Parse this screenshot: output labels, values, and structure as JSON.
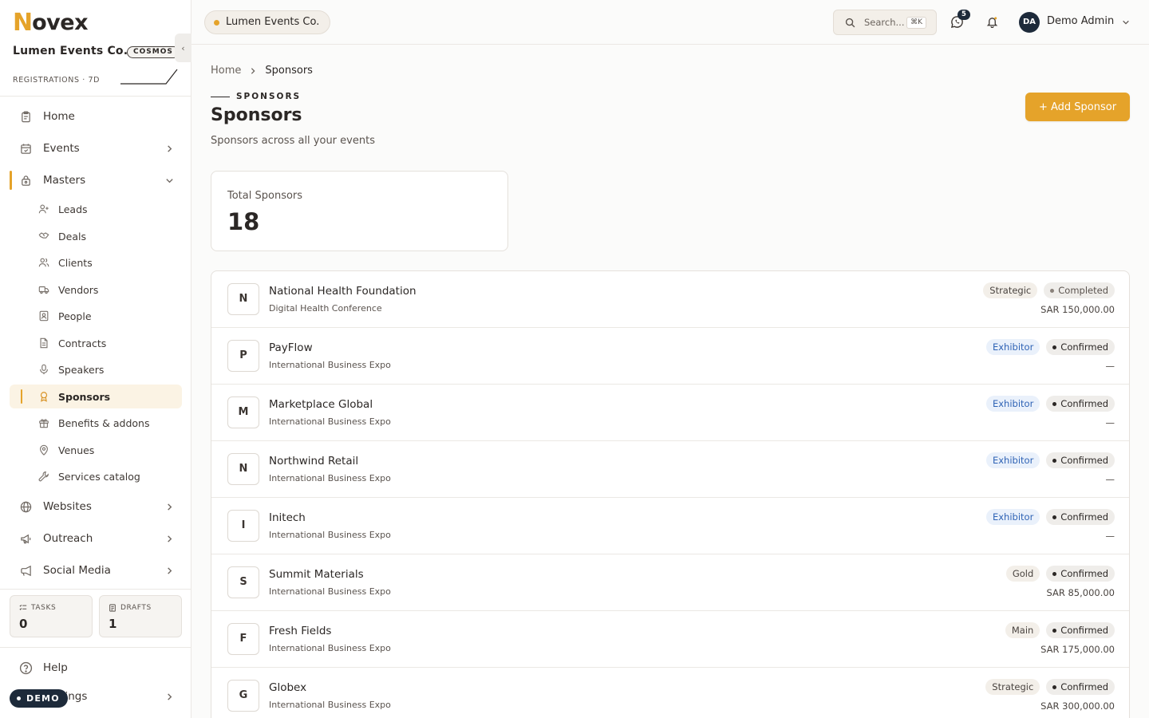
{
  "brand": {
    "logo_first": "N",
    "logo_rest": "ovex",
    "accent": "#e5a32a"
  },
  "org": {
    "name": "Lumen Events Co.",
    "badge": "COSMOS",
    "stat_label": "REGISTRATIONS · 7D"
  },
  "sidebar": {
    "collapse": "‹",
    "nav": {
      "home": "Home",
      "events": "Events",
      "masters": "Masters",
      "websites": "Websites",
      "outreach": "Outreach",
      "social": "Social Media",
      "help": "Help",
      "settings": "Settings"
    },
    "masters_items": [
      {
        "label": "Leads",
        "icon": "user-plus-icon"
      },
      {
        "label": "Deals",
        "icon": "handshake-icon"
      },
      {
        "label": "Clients",
        "icon": "users-icon"
      },
      {
        "label": "Vendors",
        "icon": "truck-icon"
      },
      {
        "label": "People",
        "icon": "contact-icon"
      },
      {
        "label": "Contracts",
        "icon": "document-icon"
      },
      {
        "label": "Speakers",
        "icon": "microphone-icon"
      },
      {
        "label": "Sponsors",
        "icon": "award-icon"
      },
      {
        "label": "Benefits & addons",
        "icon": "gift-icon"
      },
      {
        "label": "Venues",
        "icon": "map-pin-icon"
      },
      {
        "label": "Services catalog",
        "icon": "wrench-icon"
      }
    ],
    "tasks": {
      "label": "TASKS",
      "value": "0"
    },
    "drafts": {
      "label": "DRAFTS",
      "value": "1"
    },
    "demo_badge": "DEMO"
  },
  "topbar": {
    "org_pill": "Lumen Events Co.",
    "search_placeholder": "Search...",
    "search_shortcut": "⌘K",
    "notif_count": "5",
    "avatar_initials": "DA",
    "user_name": "Demo Admin"
  },
  "page": {
    "breadcrumb_home": "Home",
    "breadcrumb_current": "Sponsors",
    "eyebrow": "SPONSORS",
    "title": "Sponsors",
    "subtitle": "Sponsors across all your events",
    "add_button": "+ Add Sponsor",
    "total_label": "Total Sponsors",
    "total_value": "18"
  },
  "sponsors": [
    {
      "initial": "N",
      "name": "National Health Foundation",
      "event": "Digital Health Conference",
      "tier": "Strategic",
      "tier_style": "neutral",
      "status": "Completed",
      "status_style": "muted",
      "amount": "SAR 150,000.00"
    },
    {
      "initial": "P",
      "name": "PayFlow",
      "event": "International Business Expo",
      "tier": "Exhibitor",
      "tier_style": "blue",
      "status": "Confirmed",
      "status_style": "dark",
      "amount": "—"
    },
    {
      "initial": "M",
      "name": "Marketplace Global",
      "event": "International Business Expo",
      "tier": "Exhibitor",
      "tier_style": "blue",
      "status": "Confirmed",
      "status_style": "dark",
      "amount": "—"
    },
    {
      "initial": "N",
      "name": "Northwind Retail",
      "event": "International Business Expo",
      "tier": "Exhibitor",
      "tier_style": "blue",
      "status": "Confirmed",
      "status_style": "dark",
      "amount": "—"
    },
    {
      "initial": "I",
      "name": "Initech",
      "event": "International Business Expo",
      "tier": "Exhibitor",
      "tier_style": "blue",
      "status": "Confirmed",
      "status_style": "dark",
      "amount": "—"
    },
    {
      "initial": "S",
      "name": "Summit Materials",
      "event": "International Business Expo",
      "tier": "Gold",
      "tier_style": "neutral",
      "status": "Confirmed",
      "status_style": "dark",
      "amount": "SAR 85,000.00"
    },
    {
      "initial": "F",
      "name": "Fresh Fields",
      "event": "International Business Expo",
      "tier": "Main",
      "tier_style": "neutral",
      "status": "Confirmed",
      "status_style": "dark",
      "amount": "SAR 175,000.00"
    },
    {
      "initial": "G",
      "name": "Globex",
      "event": "International Business Expo",
      "tier": "Strategic",
      "tier_style": "neutral",
      "status": "Confirmed",
      "status_style": "dark",
      "amount": "SAR 300,000.00"
    }
  ]
}
